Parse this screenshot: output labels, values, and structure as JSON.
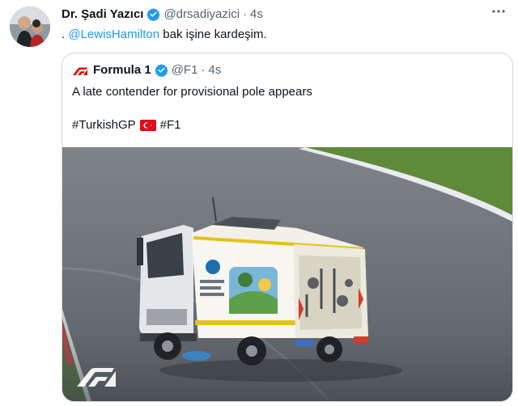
{
  "tweet": {
    "author_name": "Dr. Şadi Yazıcı",
    "handle": "@drsadiyazici",
    "separator": "·",
    "time": "4s",
    "text_prefix": ".",
    "mention": "@LewisHamilton",
    "text_rest": "bak işine kardeşim."
  },
  "quote": {
    "author_name": "Formula 1",
    "handle": "@F1",
    "separator": "·",
    "time": "4s",
    "text": "A late contender for provisional pole appears",
    "hashtag1": "#TurkishGP",
    "hashtag2": "#F1",
    "media_watermark": "F1"
  },
  "icons": {
    "verified": "verified-badge-icon",
    "more": "more-options-icon",
    "flag": "turkey-flag-icon",
    "brand": "f1-logo-icon"
  },
  "colors": {
    "link": "#1d9bf0",
    "muted": "#536471",
    "border": "#cfd9de",
    "verified": "#1d9bf0",
    "f1_red": "#e10600"
  }
}
